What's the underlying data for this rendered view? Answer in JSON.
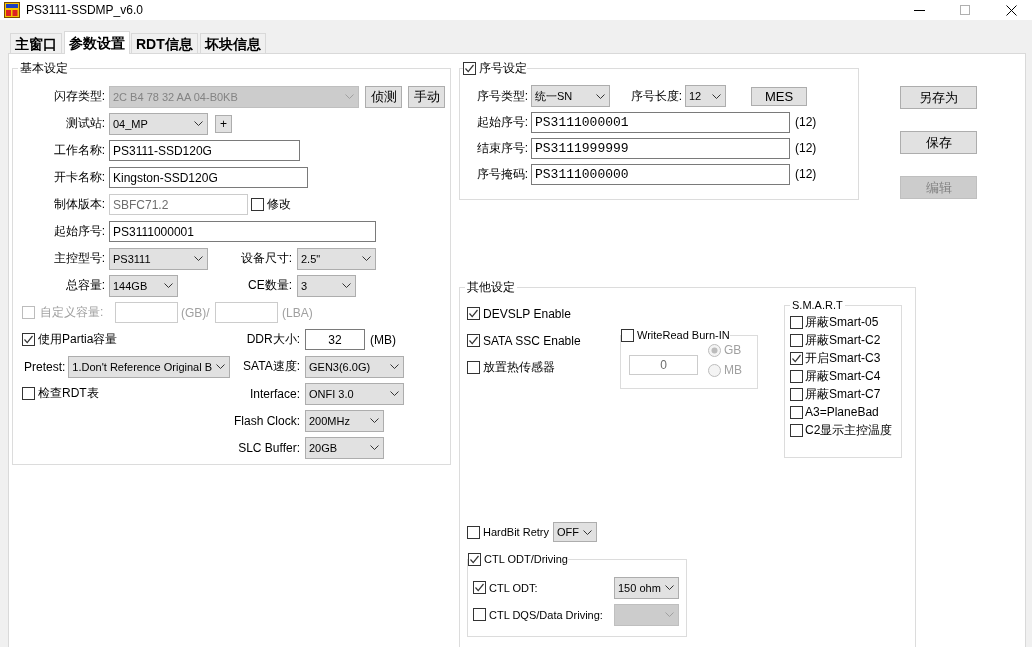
{
  "window": {
    "title": "PS3111-SSDMP_v6.0"
  },
  "tabs": [
    {
      "label": "主窗口",
      "selected": false
    },
    {
      "label": "参数设置",
      "selected": true
    },
    {
      "label": "RDT信息",
      "selected": false
    },
    {
      "label": "坏块信息",
      "selected": false
    }
  ],
  "basic_settings": {
    "title": "基本设定",
    "flash_type": {
      "label": "闪存类型:",
      "value": "2C B4 78 32 AA 04-B0KB",
      "disabled": true
    },
    "detect_button": {
      "label": "侦测"
    },
    "manual_button": {
      "label": "手动"
    },
    "test_station": {
      "label": "测试站:",
      "value": "04_MP"
    },
    "add_button": {
      "label": "+"
    },
    "job_name": {
      "label": "工作名称:",
      "value": "PS3111-SSD120G"
    },
    "card_name": {
      "label": "开卡名称:",
      "value": "Kingston-SSD120G"
    },
    "firmware_version": {
      "label": "制体版本:",
      "value": "SBFC71.2",
      "disabled": true
    },
    "modify": {
      "label": "修改",
      "checked": false
    },
    "start_serial": {
      "label": "起始序号:",
      "value": "PS3111000001"
    },
    "controller_model": {
      "label": "主控型号:",
      "value": "PS3111"
    },
    "device_size": {
      "label": "设备尺寸:",
      "value": "2.5\""
    },
    "total_capacity": {
      "label": "总容量:",
      "value": "144GB"
    },
    "ce_count": {
      "label": "CE数量:",
      "value": "3"
    },
    "custom_capacity": {
      "label": "自定义容量:",
      "checked": false,
      "disabled": true,
      "gb_unit": "(GB)/",
      "lba_unit": "(LBA)"
    },
    "use_partial": {
      "label": "使用Partia容量",
      "checked": true
    },
    "ddr_size": {
      "label": "DDR大小:",
      "value": "32",
      "unit": "(MB)"
    },
    "pretest": {
      "label": "Pretest:",
      "value": "1.Don't Reference Original B"
    },
    "sata_speed": {
      "label": "SATA速度:",
      "value": "GEN3(6.0G)"
    },
    "check_rdt": {
      "label": "检查RDT表",
      "checked": false
    },
    "interface": {
      "label": "Interface:",
      "value": "ONFI 3.0"
    },
    "flash_clock": {
      "label": "Flash Clock:",
      "value": "200MHz"
    },
    "slc_buffer": {
      "label": "SLC Buffer:",
      "value": "20GB"
    }
  },
  "serial_settings": {
    "title": "序号设定",
    "checked": true,
    "serial_type": {
      "label": "序号类型:",
      "value": "统一SN"
    },
    "serial_length": {
      "label": "序号长度:",
      "value": "12"
    },
    "mes_button": {
      "label": "MES"
    },
    "fields": [
      {
        "label": "起始序号:",
        "value": "PS3111000001",
        "length": "(12)"
      },
      {
        "label": "结束序号:",
        "value": "PS3111999999",
        "length": "(12)"
      },
      {
        "label": "序号掩码:",
        "value": "PS3111000000",
        "length": "(12)"
      }
    ]
  },
  "side_buttons": [
    {
      "label": "另存为",
      "disabled": false
    },
    {
      "label": "保存",
      "disabled": false
    },
    {
      "label": "编辑",
      "disabled": true
    }
  ],
  "other_settings": {
    "title": "其他设定",
    "options": [
      {
        "label": "DEVSLP Enable",
        "checked": true
      },
      {
        "label": "SATA SSC Enable",
        "checked": true
      },
      {
        "label": "放置热传感器",
        "checked": false
      }
    ],
    "burn_in": {
      "label": "WriteRead Burn-IN",
      "checked": false,
      "value": "0",
      "units": [
        {
          "label": "GB",
          "selected": true
        },
        {
          "label": "MB",
          "selected": false
        }
      ]
    },
    "smart": {
      "title": "S.M.A.R.T",
      "items": [
        {
          "label": "屏蔽Smart-05",
          "checked": false
        },
        {
          "label": "屏蔽Smart-C2",
          "checked": false
        },
        {
          "label": "开启Smart-C3",
          "checked": true
        },
        {
          "label": "屏蔽Smart-C4",
          "checked": false
        },
        {
          "label": "屏蔽Smart-C7",
          "checked": false
        },
        {
          "label": "A3=PlaneBad",
          "checked": false
        },
        {
          "label": "C2显示主控温度",
          "checked": false
        }
      ]
    },
    "hardbit_retry": {
      "label": "HardBit Retry",
      "checked": false,
      "value": "OFF"
    },
    "ctl_odt_driving": {
      "label": "CTL ODT/Driving",
      "checked": true,
      "items": [
        {
          "label": "CTL ODT:",
          "checked": true,
          "value": "150 ohm",
          "disabled": false
        },
        {
          "label": "CTL DQS/Data Driving:",
          "checked": false,
          "disabled": true
        }
      ]
    }
  }
}
